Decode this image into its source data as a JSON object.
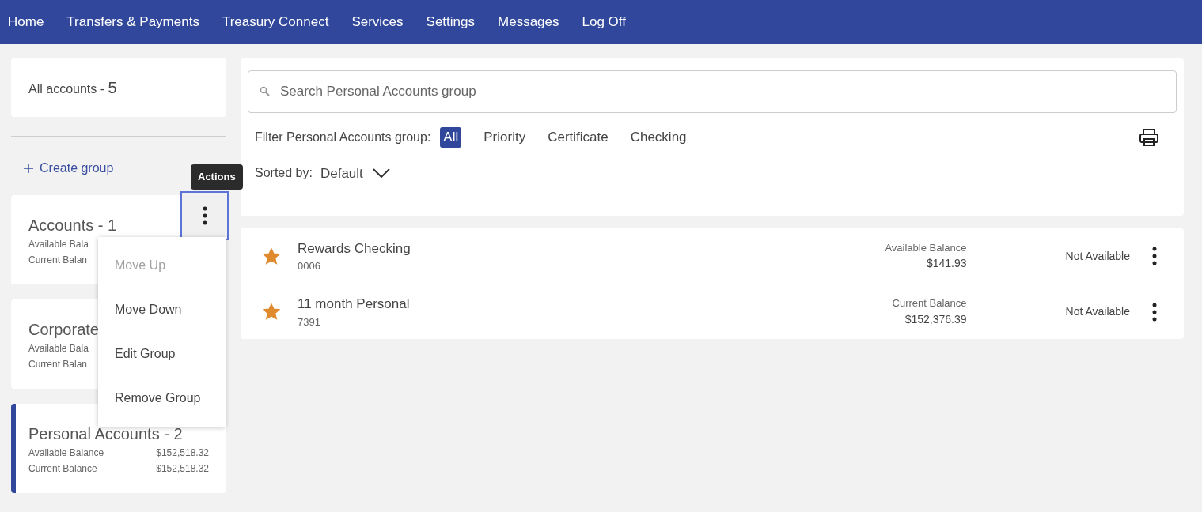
{
  "nav": [
    {
      "label": "Home"
    },
    {
      "label": "Transfers & Payments"
    },
    {
      "label": "Treasury Connect"
    },
    {
      "label": "Services"
    },
    {
      "label": "Settings"
    },
    {
      "label": "Messages"
    },
    {
      "label": "Log Off"
    }
  ],
  "sidebar": {
    "all_accounts": {
      "label": "All accounts - ",
      "count": "5"
    },
    "create_group": "Create group",
    "groups": [
      {
        "name": "Accounts - 1",
        "selected": false,
        "rows": [
          {
            "label": "Available Bala"
          },
          {
            "label": "Current Balan"
          }
        ]
      },
      {
        "name": "Corporate",
        "selected": false,
        "rows": [
          {
            "label": "Available Bala"
          },
          {
            "label": "Current Balan"
          }
        ]
      },
      {
        "name": "Personal Accounts - 2",
        "selected": true,
        "rows": [
          {
            "label": "Available Balance",
            "value": "$152,518.32"
          },
          {
            "label": "Current Balance",
            "value": "$152,518.32"
          }
        ]
      }
    ],
    "tooltip": "Actions",
    "menu": [
      {
        "label": "Move Up",
        "disabled": true
      },
      {
        "label": "Move Down",
        "disabled": false
      },
      {
        "label": "Edit Group",
        "disabled": false
      },
      {
        "label": "Remove Group",
        "disabled": false
      }
    ]
  },
  "search": {
    "placeholder": "Search Personal Accounts group"
  },
  "filter": {
    "label": "Filter Personal Accounts group:",
    "options": [
      {
        "label": "All",
        "selected": true
      },
      {
        "label": "Priority",
        "selected": false
      },
      {
        "label": "Certificate",
        "selected": false
      },
      {
        "label": "Checking",
        "selected": false
      }
    ]
  },
  "sort": {
    "label": "Sorted by:",
    "value": "Default"
  },
  "accounts": [
    {
      "name": "Rewards Checking",
      "number": "0006",
      "favorite": true,
      "balance_label": "Available Balance",
      "balance": "$141.93",
      "status": "Not Available"
    },
    {
      "name": "11 month Personal",
      "number": "7391",
      "favorite": true,
      "balance_label": "Current Balance",
      "balance": "$152,376.39",
      "status": "Not Available"
    }
  ]
}
